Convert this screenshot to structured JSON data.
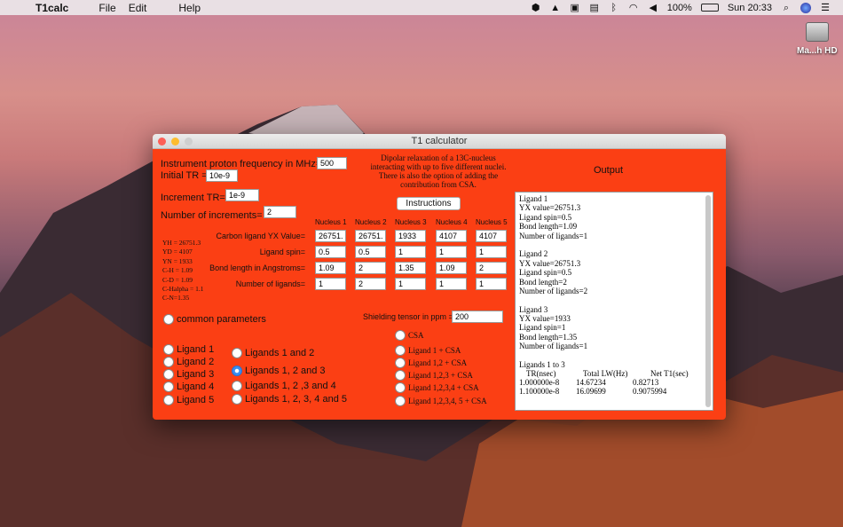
{
  "menubar": {
    "app_name": "T1calc",
    "menus": [
      "File",
      "Edit",
      "Help"
    ],
    "battery": "100%",
    "clock": "Sun 20:33"
  },
  "desktop": {
    "disk_label": "Ma...h HD"
  },
  "window": {
    "title": "T1 calculator",
    "freq_label": "Instrument proton frequency in MHz=",
    "freq_value": "500",
    "initial_tr_label": "Initial TR =",
    "initial_tr_value": "10e-9",
    "increment_tr_label": "Increment TR=",
    "increment_tr_value": "1e-9",
    "num_increments_label": "Number of increments=",
    "num_increments_value": "2",
    "description": [
      "Dipolar relaxation of a 13C-nucleus",
      "interacting with up to five different nuclei.",
      "There is also the option of adding the",
      "contribution from CSA."
    ],
    "instructions_button": "Instructions",
    "output_label": "Output",
    "nuclei_headers": [
      "Nucleus 1",
      "Nucleus 2",
      "Nucleus 3",
      "Nucleus 4",
      "Nucleus 5"
    ],
    "row_labels": [
      "Carbon ligand YX Value=",
      "Ligand spin=",
      "Bond length in Angstroms=",
      "Number of ligands="
    ],
    "rows": [
      [
        "26751.",
        "26751.",
        "1933",
        "4107",
        "4107"
      ],
      [
        "0.5",
        "0.5",
        "1",
        "1",
        "1"
      ],
      [
        "1.09",
        "2",
        "1.35",
        "1.09",
        "2"
      ],
      [
        "1",
        "2",
        "1",
        "1",
        "1"
      ]
    ],
    "constants": [
      "YH = 26751.3",
      "YD = 4107",
      "YN = 1933",
      "C-H = 1.09",
      "C-D = 1.09",
      "C-Halpha = 1.1",
      "C-N=1.35"
    ],
    "common_params": "common parameters",
    "shielding_label": "Shielding tensor in ppm =",
    "shielding_value": "200",
    "ligand_radios": [
      "Ligand 1",
      "Ligand 2",
      "Ligand 3",
      "Ligand 4",
      "Ligand 5"
    ],
    "combo_radios": [
      "Ligands 1 and 2",
      "Ligands 1, 2 and 3",
      "Ligands 1, 2 ,3 and 4",
      "Ligands 1, 2, 3, 4 and 5"
    ],
    "csa_radios": [
      "CSA",
      "Ligand 1 + CSA",
      "Ligand 1,2 + CSA",
      "Ligand 1,2,3 + CSA",
      "Ligand 1,2,3,4 + CSA",
      "Ligand 1,2,3,4, 5 + CSA"
    ],
    "selected_combo": 1,
    "output_lines": [
      "Ligand 1",
      "YX value=26751.3",
      "Ligand spin=0.5",
      "Bond length=1.09",
      "Number of ligands=1",
      "",
      "Ligand 2",
      "YX value=26751.3",
      "Ligand spin=0.5",
      "Bond length=2",
      "Number of ligands=2",
      "",
      "Ligand 3",
      "YX value=1933",
      "Ligand spin=1",
      "Bond length=1.35",
      "Number of ligands=1",
      "",
      "Ligands 1 to 3"
    ],
    "output_table": {
      "headers": [
        "TR(nsec)",
        "Total LW(Hz)",
        "Net T1(sec)"
      ],
      "rows": [
        [
          "1.000000e-8",
          "14.67234",
          "0.82713"
        ],
        [
          "1.100000e-8",
          "16.09699",
          "0.9075994"
        ]
      ]
    }
  }
}
